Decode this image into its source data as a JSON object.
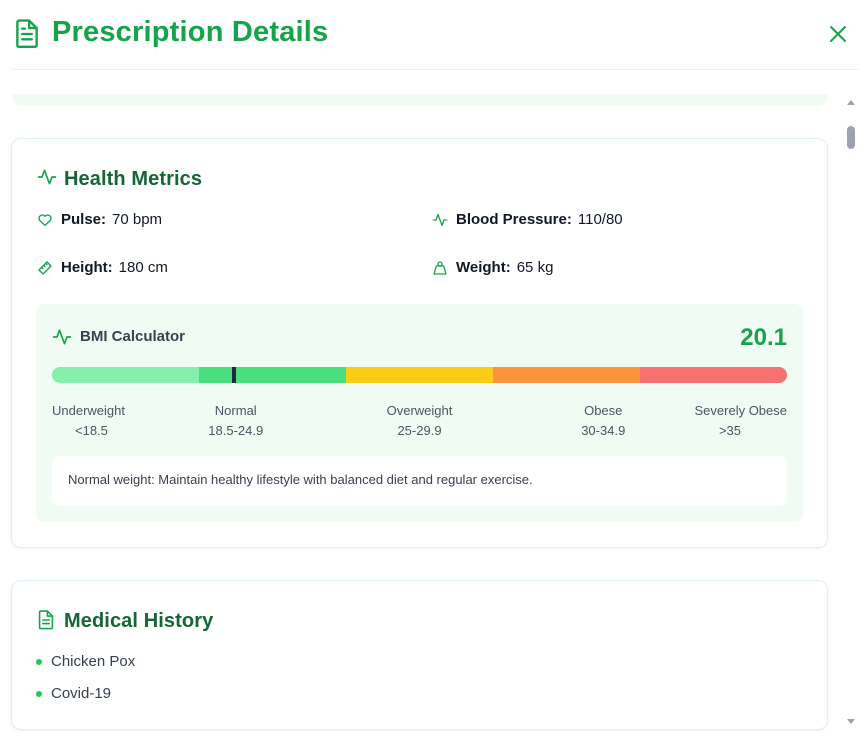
{
  "header": {
    "title": "Prescription Details",
    "title_icon": "document-icon",
    "close_icon": "close-icon"
  },
  "health_metrics": {
    "title": "Health Metrics",
    "icon": "activity-icon",
    "items": [
      {
        "label": "Pulse:",
        "value": "70 bpm",
        "icon": "heart-icon"
      },
      {
        "label": "Blood Pressure:",
        "value": "110/80",
        "icon": "activity-icon"
      },
      {
        "label": "Height:",
        "value": "180 cm",
        "icon": "ruler-icon"
      },
      {
        "label": "Weight:",
        "value": "65 kg",
        "icon": "weight-icon"
      }
    ],
    "bmi": {
      "title": "BMI Calculator",
      "icon": "activity-icon",
      "value": "20.1",
      "ranges": [
        {
          "name": "Underweight",
          "range": "<18.5",
          "color": "#86efac"
        },
        {
          "name": "Normal",
          "range": "18.5-24.9",
          "color": "#4ade80"
        },
        {
          "name": "Overweight",
          "range": "25-29.9",
          "color": "#facc15"
        },
        {
          "name": "Obese",
          "range": "30-34.9",
          "color": "#fb923c"
        },
        {
          "name": "Severely Obese",
          "range": ">35",
          "color": "#f87171"
        }
      ],
      "marker_fraction": 0.248,
      "advice": "Normal weight: Maintain healthy lifestyle with balanced diet and regular exercise."
    }
  },
  "medical_history": {
    "title": "Medical History",
    "icon": "document-icon",
    "items": [
      "Chicken Pox",
      "Covid-19"
    ]
  },
  "colors": {
    "accent": "#16a34a",
    "heading": "#166534",
    "card_tint": "#f0fbf3"
  }
}
